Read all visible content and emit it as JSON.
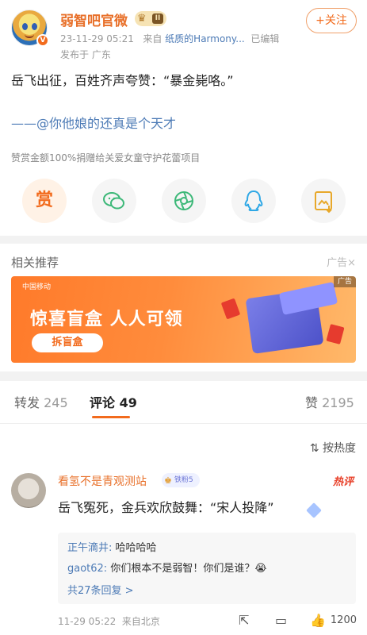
{
  "post": {
    "author": "弱智吧官微",
    "vip_level": "II",
    "timestamp": "23-11-29 05:21",
    "source_prefix": "来自",
    "source": "纸质的Harmony...",
    "edited": "已编辑",
    "location": "发布于 广东",
    "follow_label": "+关注",
    "text": "岳飞出征，百姓齐声夸赞：“暴金毙咯。”",
    "mention": "——@你他娘的还真是个天才",
    "reward_note": "赞赏金额100%捐赠给关爱女童守护花蕾项目",
    "reward_label": "赏"
  },
  "share_icons": [
    "reward-icon",
    "wechat-icon",
    "moments-icon",
    "qq-icon",
    "save-image-icon"
  ],
  "recommend": {
    "title": "相关推荐",
    "ad_label": "广告×",
    "banner": {
      "brand": "中国移动",
      "headline": "惊喜盲盒  人人可领",
      "cta": "拆盲盒",
      "ad_tag": "广告"
    }
  },
  "tabs": [
    {
      "label": "转发",
      "count": "245"
    },
    {
      "label": "评论",
      "count": "49"
    },
    {
      "label": "赞",
      "count": "2195"
    }
  ],
  "sort_label": "按热度",
  "comment": {
    "author": "看氢不是青观测站",
    "fan_badge": "铁粉5",
    "hot_tag": "热评",
    "text": "岳飞冤死，金兵欢欣鼓舞：“宋人投降”",
    "replies": [
      {
        "name": "正午滴井:",
        "text": "哈哈哈哈"
      },
      {
        "name": "gaot62:",
        "text": "你们根本不是弱智！你们是谁？😭"
      }
    ],
    "more_replies": "共27条回复 >",
    "timestamp": "11-29 05:22",
    "location": "来自北京",
    "like_count": "1200"
  }
}
